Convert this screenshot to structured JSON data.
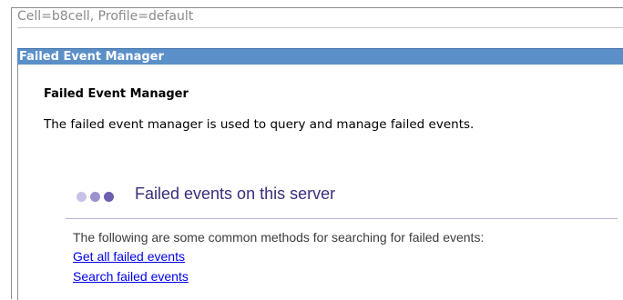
{
  "context": {
    "label": "Cell=b8cell, Profile=default"
  },
  "titlebar": {
    "title": "Failed Event Manager"
  },
  "content": {
    "heading": "Failed Event Manager",
    "description": "The failed event manager is used to query and manage failed events."
  },
  "section": {
    "title": "Failed events on this server",
    "intro": "The following are some common methods for searching for failed events:",
    "links": [
      {
        "label": "Get all failed events"
      },
      {
        "label": "Search failed events"
      }
    ],
    "dot_colors": [
      "#c9c2e8",
      "#9d92cf",
      "#6a5fb2"
    ]
  },
  "colors": {
    "titlebar_bg": "#5b8fc8",
    "section_title": "#3a2e7a",
    "link": "#0000ee"
  }
}
